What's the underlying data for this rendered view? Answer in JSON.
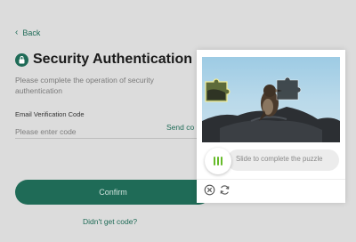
{
  "page": {
    "back_label": "Back",
    "title": "Security Authentication",
    "description": "Please complete the operation of security authentication",
    "email_label": "Email Verification Code",
    "email_placeholder": "Please enter code",
    "send_code_label": "Send co",
    "confirm_label": "Confirm",
    "no_code_label": "Didn't get code?",
    "accent_color": "#1f6b57"
  },
  "captcha": {
    "slider_text": "Slide to complete the puzzle",
    "handle_icon": "grip-lines-icon",
    "close_icon": "close-circle-icon",
    "refresh_icon": "refresh-icon",
    "handle_color": "#66bb2a"
  }
}
